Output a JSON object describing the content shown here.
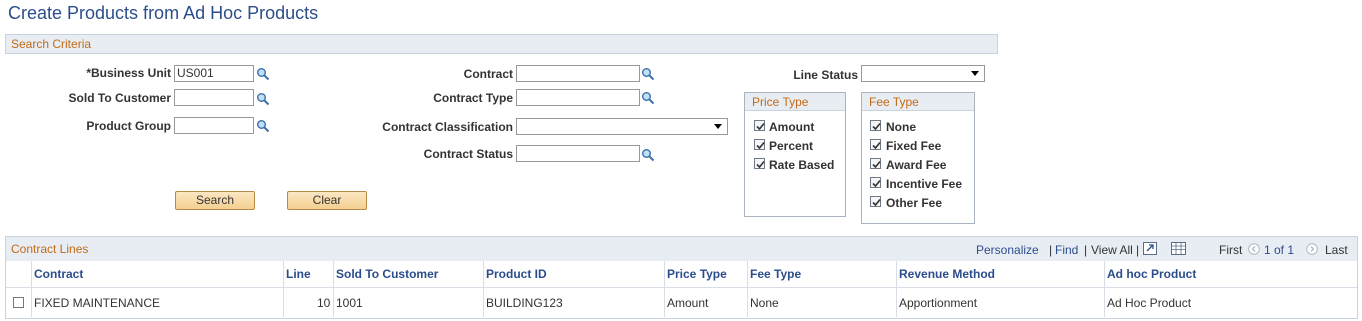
{
  "page": {
    "title": "Create Products from Ad Hoc Products"
  },
  "search_criteria": {
    "header": "Search Criteria",
    "business_unit": {
      "label": "*Business Unit",
      "value": "US001"
    },
    "sold_to_customer": {
      "label": "Sold To Customer",
      "value": ""
    },
    "product_group": {
      "label": "Product Group",
      "value": ""
    },
    "contract": {
      "label": "Contract",
      "value": ""
    },
    "contract_type": {
      "label": "Contract Type",
      "value": ""
    },
    "contract_classification": {
      "label": "Contract Classification",
      "value": ""
    },
    "contract_status": {
      "label": "Contract Status",
      "value": ""
    },
    "line_status": {
      "label": "Line Status",
      "value": ""
    },
    "price_type": {
      "header": "Price Type",
      "options": [
        {
          "label": "Amount",
          "checked": true
        },
        {
          "label": "Percent",
          "checked": true
        },
        {
          "label": "Rate Based",
          "checked": true
        }
      ]
    },
    "fee_type": {
      "header": "Fee Type",
      "options": [
        {
          "label": "None",
          "checked": true
        },
        {
          "label": "Fixed Fee",
          "checked": true
        },
        {
          "label": "Award Fee",
          "checked": true
        },
        {
          "label": "Incentive Fee",
          "checked": true
        },
        {
          "label": "Other Fee",
          "checked": true
        }
      ]
    },
    "search_button": "Search",
    "clear_button": "Clear"
  },
  "contract_lines": {
    "header": "Contract Lines",
    "nav": {
      "personalize": "Personalize",
      "sep1": "|",
      "find": "Find",
      "sep2": "|",
      "view_all": "View All",
      "sep3": "|",
      "first": "First",
      "page_info": "1 of 1",
      "last": "Last"
    },
    "columns": [
      "Contract",
      "Line",
      "Sold To Customer",
      "Product ID",
      "Price Type",
      "Fee Type",
      "Revenue Method",
      "Ad hoc Product"
    ],
    "rows": [
      {
        "checked": false,
        "contract": "FIXED MAINTENANCE",
        "line": "10",
        "sold_to": "1001",
        "product_id": "BUILDING123",
        "price_type": "Amount",
        "fee_type": "None",
        "revenue_method": "Apportionment",
        "adhoc_product": "Ad Hoc Product"
      }
    ]
  },
  "colors": {
    "title": "#2c4d8c",
    "section_header": "#c36b16",
    "link": "#2c4d8c",
    "header_bg": "#e8edf3"
  }
}
